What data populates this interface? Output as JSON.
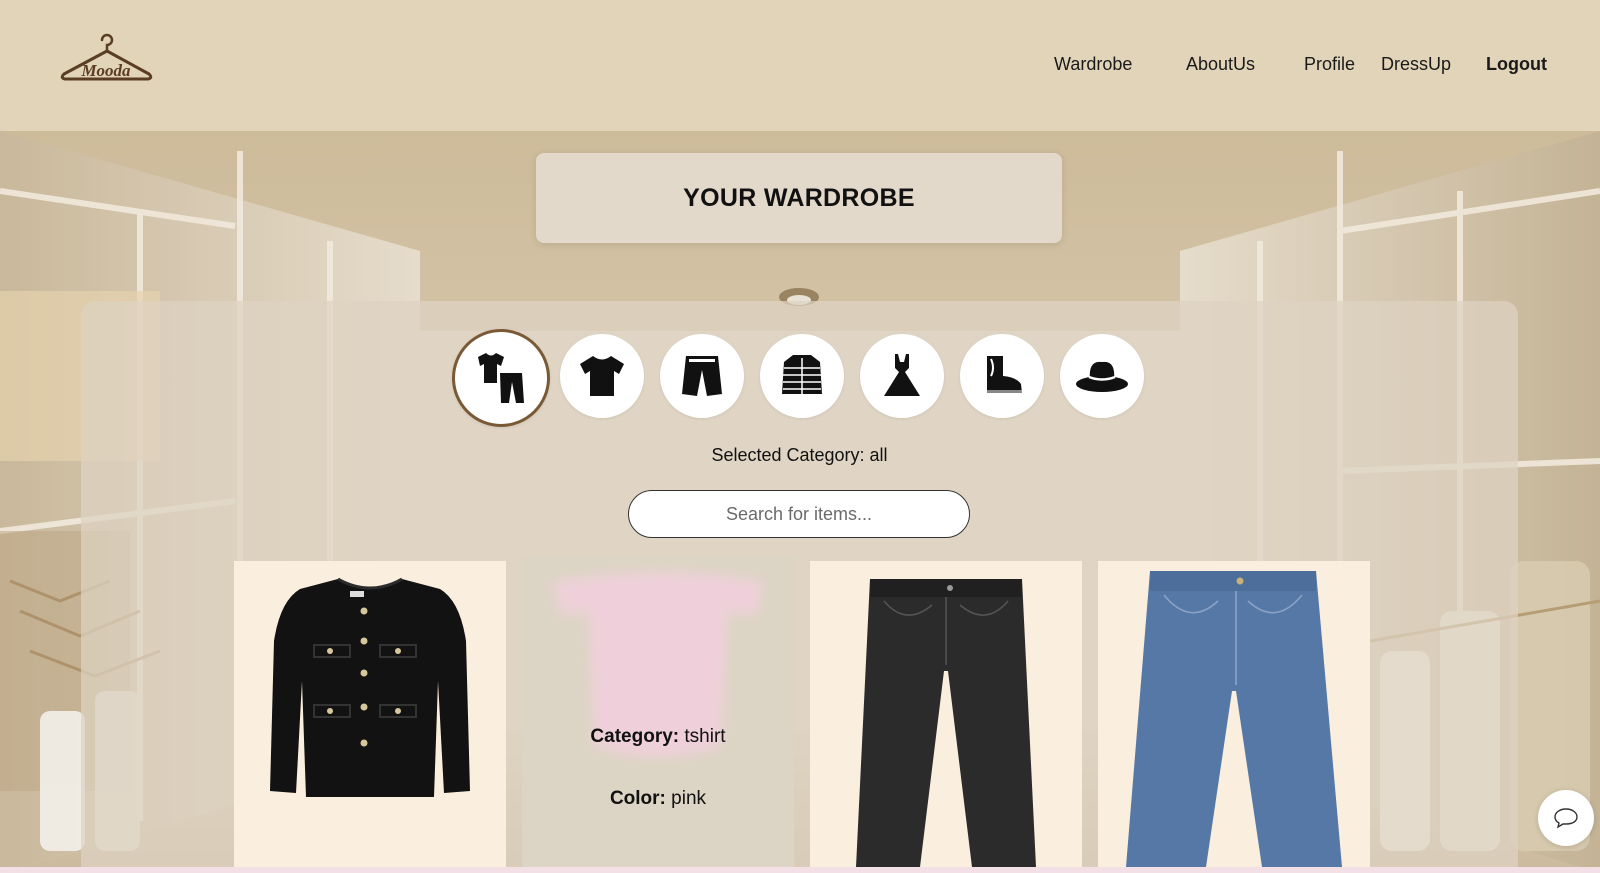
{
  "app": {
    "logo_text": "Mooda"
  },
  "nav": {
    "wardrobe": "Wardrobe",
    "about": "AboutUs",
    "profile": "Profile",
    "dressup": "DressUp",
    "logout": "Logout"
  },
  "page": {
    "title": "YOUR WARDROBE"
  },
  "categories": [
    {
      "icon": "all-clothes-icon",
      "active": true
    },
    {
      "icon": "tshirt-icon",
      "active": false
    },
    {
      "icon": "shorts-icon",
      "active": false
    },
    {
      "icon": "jacket-icon",
      "active": false
    },
    {
      "icon": "dress-icon",
      "active": false
    },
    {
      "icon": "boot-icon",
      "active": false
    },
    {
      "icon": "hat-icon",
      "active": false
    }
  ],
  "filter": {
    "selected_label": "Selected Category: all"
  },
  "search": {
    "placeholder": "Search for items..."
  },
  "items": [
    {
      "image": "black-cropped-jacket"
    },
    {
      "image": "pink-off-shoulder-top",
      "category_label": "Category:",
      "category": "tshirt",
      "color_label": "Color:",
      "color": "pink"
    },
    {
      "image": "black-wide-leg-jeans"
    },
    {
      "image": "blue-wide-leg-jeans"
    }
  ],
  "chat": {
    "icon": "chat-bubble-icon"
  },
  "colors": {
    "header_bg": "#e2d4b9",
    "card_bg": "#faefdf",
    "accent_border": "#7a5a36"
  }
}
